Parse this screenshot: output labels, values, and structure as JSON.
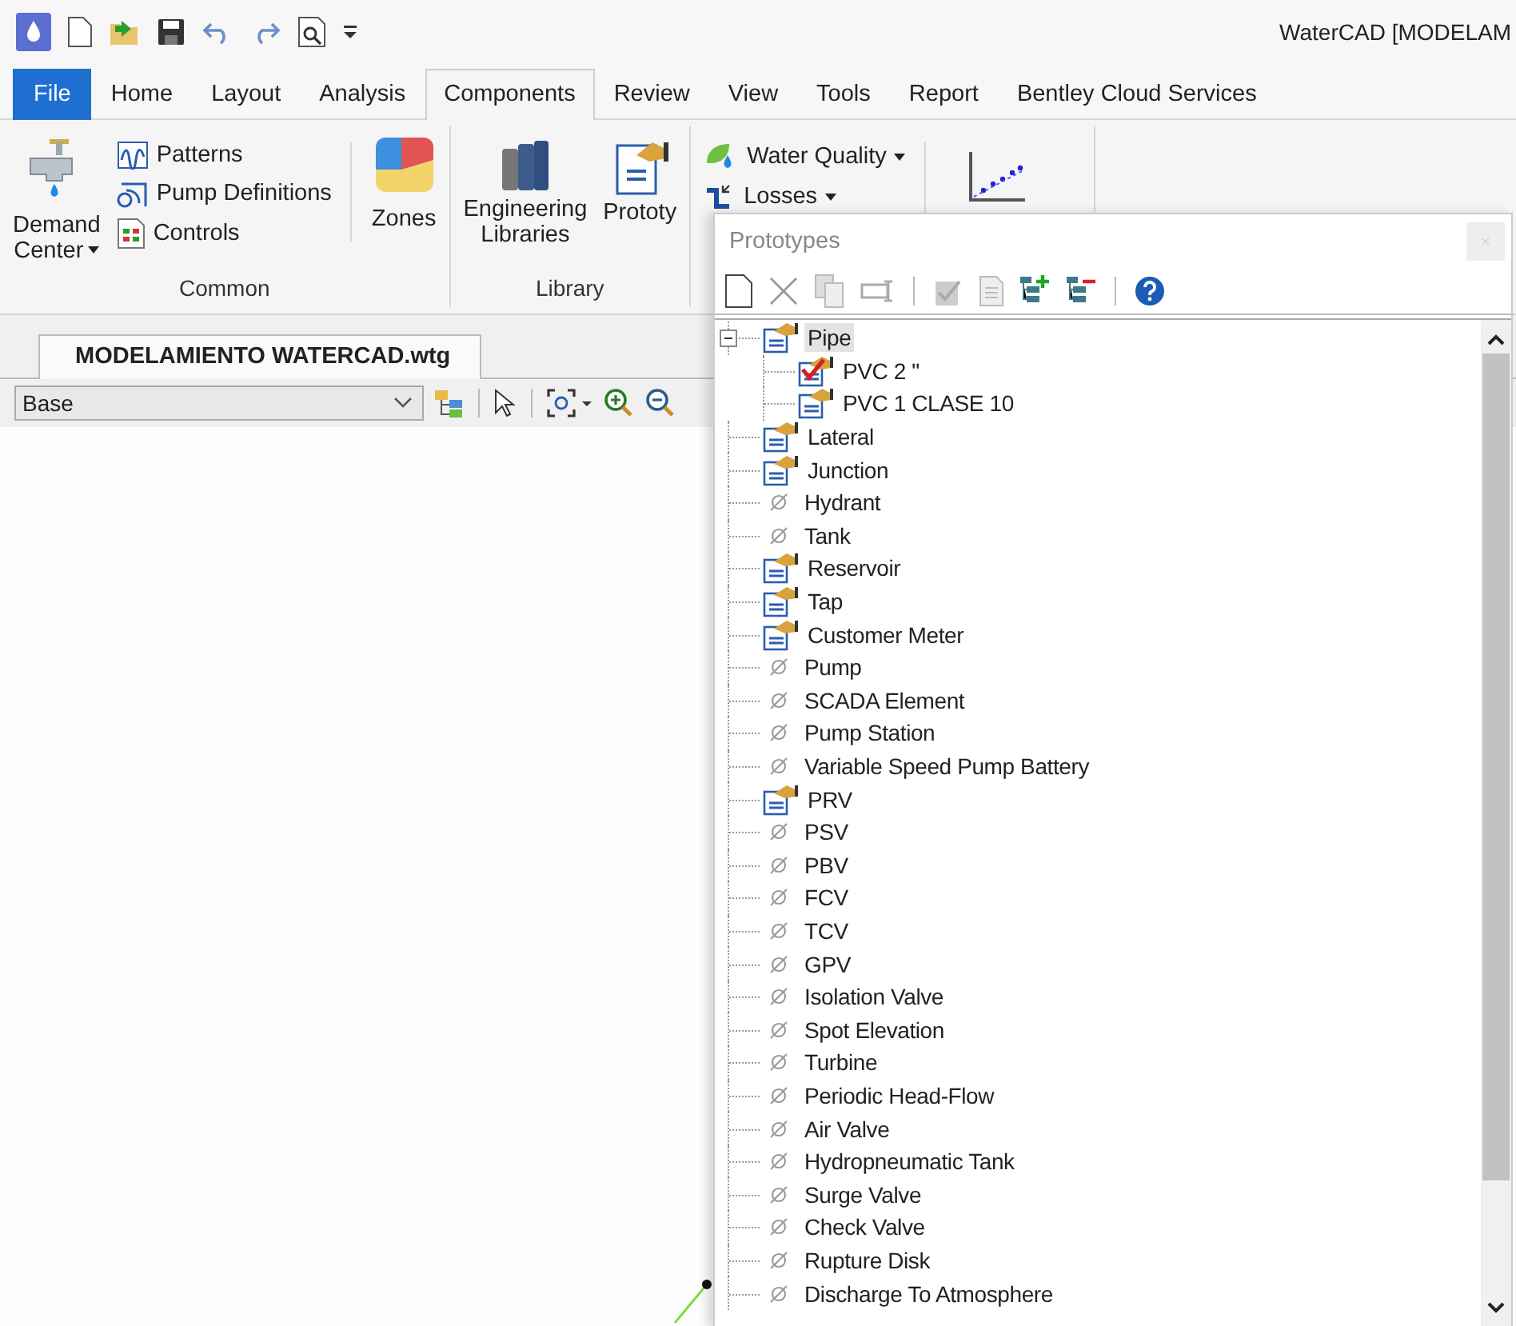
{
  "window": {
    "title": "WaterCAD [MODELAM"
  },
  "ribbon_tabs": [
    {
      "label": "File",
      "kind": "file",
      "selected": false
    },
    {
      "label": "Home",
      "kind": "tab",
      "selected": false
    },
    {
      "label": "Layout",
      "kind": "tab",
      "selected": false
    },
    {
      "label": "Analysis",
      "kind": "tab",
      "selected": false
    },
    {
      "label": "Components",
      "kind": "tab",
      "selected": true
    },
    {
      "label": "Review",
      "kind": "tab",
      "selected": false
    },
    {
      "label": "View",
      "kind": "tab",
      "selected": false
    },
    {
      "label": "Tools",
      "kind": "tab",
      "selected": false
    },
    {
      "label": "Report",
      "kind": "tab",
      "selected": false
    },
    {
      "label": "Bentley Cloud Services",
      "kind": "tab",
      "selected": false
    }
  ],
  "common_group": {
    "label": "Common",
    "demand_center": [
      "Demand",
      "Center"
    ],
    "small_buttons": [
      {
        "label": "Patterns",
        "kind": "patterns"
      },
      {
        "label": "Pump Definitions",
        "kind": "pump"
      },
      {
        "label": "Controls",
        "kind": "controls"
      }
    ],
    "zones": "Zones"
  },
  "library_group": {
    "label": "Library",
    "engineering_libraries": [
      "Engineering",
      "Libraries"
    ],
    "prototypes": "Prototy"
  },
  "quality_group": {
    "water_quality": "Water Quality",
    "losses": "Losses"
  },
  "document_tab": "MODELAMIENTO WATERCAD.wtg",
  "layer_select": {
    "value": "Base"
  },
  "prototypes_panel": {
    "title": "Prototypes",
    "tree": [
      {
        "label": "Pipe",
        "kind": "prototype",
        "expanded": true,
        "selected": true,
        "children": [
          {
            "label": "PVC 2 \"",
            "kind": "prototype",
            "default": true,
            "selected": false
          },
          {
            "label": "PVC 1 CLASE 10",
            "kind": "prototype",
            "default": false,
            "selected": false
          }
        ]
      },
      {
        "label": "Lateral",
        "kind": "prototype",
        "selected": false
      },
      {
        "label": "Junction",
        "kind": "prototype",
        "selected": false
      },
      {
        "label": "Hydrant",
        "kind": "empty",
        "selected": false
      },
      {
        "label": "Tank",
        "kind": "empty",
        "selected": false
      },
      {
        "label": "Reservoir",
        "kind": "prototype",
        "selected": false
      },
      {
        "label": "Tap",
        "kind": "prototype",
        "selected": false
      },
      {
        "label": "Customer Meter",
        "kind": "prototype",
        "selected": false
      },
      {
        "label": "Pump",
        "kind": "empty",
        "selected": false
      },
      {
        "label": "SCADA Element",
        "kind": "empty",
        "selected": false
      },
      {
        "label": "Pump Station",
        "kind": "empty",
        "selected": false
      },
      {
        "label": "Variable Speed Pump Battery",
        "kind": "empty",
        "selected": false
      },
      {
        "label": "PRV",
        "kind": "prototype",
        "selected": false
      },
      {
        "label": "PSV",
        "kind": "empty",
        "selected": false
      },
      {
        "label": "PBV",
        "kind": "empty",
        "selected": false
      },
      {
        "label": "FCV",
        "kind": "empty",
        "selected": false
      },
      {
        "label": "TCV",
        "kind": "empty",
        "selected": false
      },
      {
        "label": "GPV",
        "kind": "empty",
        "selected": false
      },
      {
        "label": "Isolation Valve",
        "kind": "empty",
        "selected": false
      },
      {
        "label": "Spot Elevation",
        "kind": "empty",
        "selected": false
      },
      {
        "label": "Turbine",
        "kind": "empty",
        "selected": false
      },
      {
        "label": "Periodic Head-Flow",
        "kind": "empty",
        "selected": false
      },
      {
        "label": "Air Valve",
        "kind": "empty",
        "selected": false
      },
      {
        "label": "Hydropneumatic Tank",
        "kind": "empty",
        "selected": false
      },
      {
        "label": "Surge Valve",
        "kind": "empty",
        "selected": false
      },
      {
        "label": "Check Valve",
        "kind": "empty",
        "selected": false
      },
      {
        "label": "Rupture Disk",
        "kind": "empty",
        "selected": false
      },
      {
        "label": "Discharge To Atmosphere",
        "kind": "empty",
        "selected": false
      }
    ]
  }
}
